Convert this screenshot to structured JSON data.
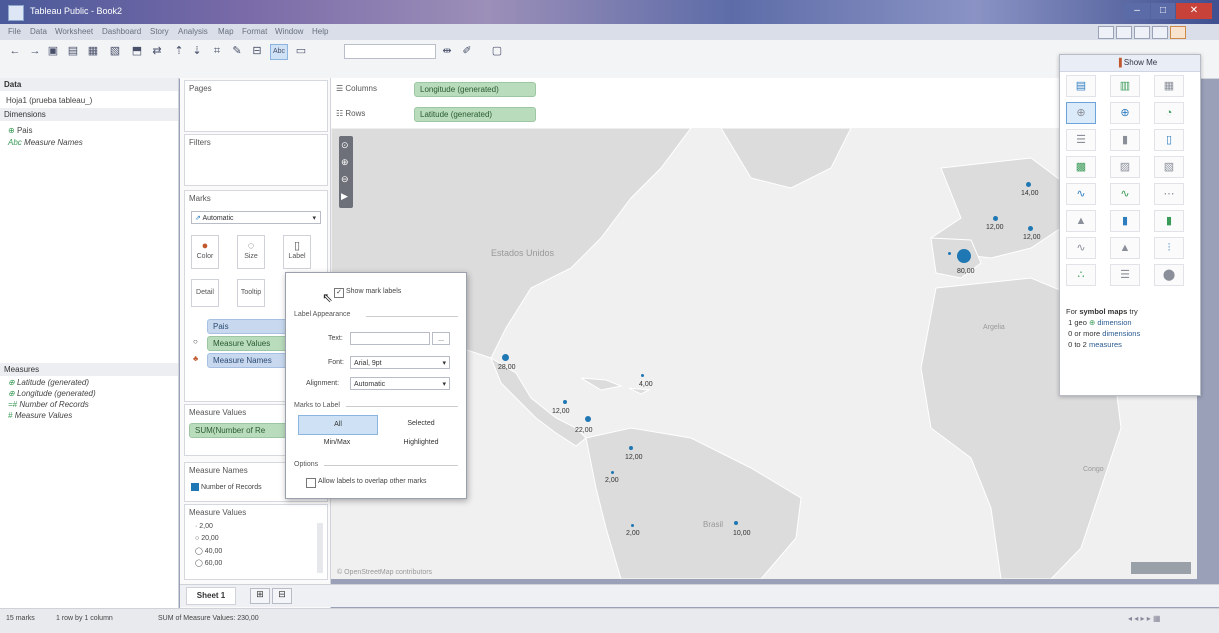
{
  "window": {
    "title": "Tableau Public - Book2",
    "controls": [
      "–",
      "□",
      "✕"
    ]
  },
  "menu": [
    "File",
    "Data",
    "Worksheet",
    "Dashboard",
    "Story",
    "Analysis",
    "Map",
    "Format",
    "Window",
    "Help"
  ],
  "data_pane": {
    "header": "Data",
    "source": "Hoja1 (prueba tableau_)",
    "dimensions_header": "Dimensions",
    "dimensions": [
      "Pais",
      "Measure Names"
    ],
    "measures_header": "Measures",
    "measures": [
      "Latitude (generated)",
      "Longitude (generated)",
      "Number of Records",
      "Measure Values"
    ]
  },
  "shelves": {
    "pages": "Pages",
    "filters": "Filters",
    "marks": "Marks",
    "mark_type": "Automatic",
    "mark_buttons": [
      "Color",
      "Size",
      "Label",
      "Detail",
      "Tooltip"
    ],
    "mark_pills": [
      "Pais",
      "Measure Values",
      "Measure Names"
    ],
    "measure_values_header": "Measure Values",
    "measure_values_pill": "SUM(Number of Re",
    "measure_names_header": "Measure Names",
    "measure_names_item": "Number of Records",
    "size_legend_header": "Measure Values",
    "size_legend": [
      "2,00",
      "20,00",
      "40,00",
      "60,00"
    ]
  },
  "columns": {
    "label": "Columns",
    "pill": "Longitude (generated)"
  },
  "rows": {
    "label": "Rows",
    "pill": "Latitude (generated)"
  },
  "map": {
    "labels": {
      "usa": "Estados Unidos",
      "brazil": "Brasil",
      "algeria": "Argelia",
      "congo": "Congo"
    },
    "attribution": "© OpenStreetMap contributors",
    "values": [
      "14,00",
      "12,00",
      "12,00",
      "80,00",
      "28,00",
      "4,00",
      "12,00",
      "22,00",
      "12,00",
      "2,00",
      "2,00",
      "10,00"
    ]
  },
  "showme": {
    "title": "Show Me",
    "hint_prefix": "For",
    "hint_bold": "symbol maps",
    "hint_suffix": "try",
    "hint_lines": [
      "1 geo",
      "dimension",
      "0 or more",
      "dimensions",
      "0 to 2",
      "measures"
    ]
  },
  "label_popup": {
    "show_labels": "Show mark labels",
    "appearance": "Label Appearance",
    "text": "Text:",
    "font": "Font:",
    "font_value": "Arial, 9pt",
    "alignment": "Alignment:",
    "alignment_value": "Automatic",
    "marks_to_label": "Marks to Label",
    "options_marks": [
      "All",
      "Selected",
      "Min/Max",
      "Highlighted"
    ],
    "options": "Options",
    "overlap": "Allow labels to overlap other marks"
  },
  "sheet_tab": "Sheet 1",
  "status": {
    "marks": "15 marks",
    "grid": "1 row by 1 column",
    "sum": "SUM of Measure Values: 230,00"
  },
  "colors": {
    "accent": "#1f77b4",
    "green_pill": "#b9dcbc",
    "blue_pill": "#c8d9ef"
  }
}
